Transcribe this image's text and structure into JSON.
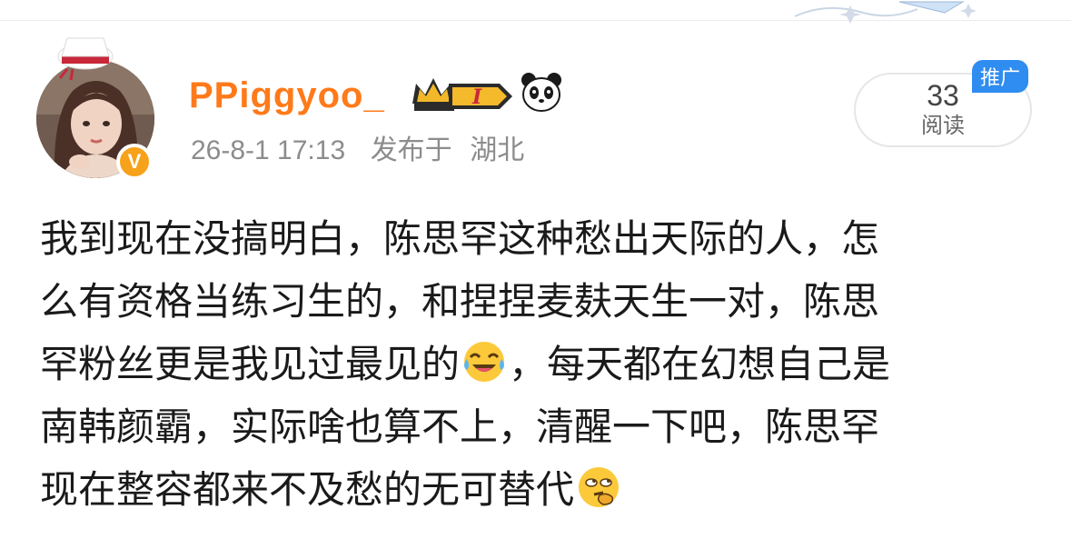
{
  "post": {
    "author": {
      "username": "PPiggyoo_",
      "verified_badge": "V",
      "level_badge": "I",
      "avatar_icon": "avatar-girl-icon",
      "badge_icons": [
        "crown-level-icon",
        "panda-icon"
      ]
    },
    "meta": {
      "time": "26-8-1 17:13",
      "published_prefix": "发布于",
      "location": "湖北"
    },
    "read": {
      "count": "33",
      "label": "阅读"
    },
    "promo_tag": "推广",
    "body": {
      "lines": [
        {
          "segments": [
            {
              "text": "我到现在没搞明白，陈思罕这种愁出天际的人，怎"
            }
          ]
        },
        {
          "segments": [
            {
              "text": "么有资格当练习生的，和捏捏麦麸天生一对，陈思"
            }
          ]
        },
        {
          "segments": [
            {
              "text": "罕粉丝更是我见过最见的"
            },
            {
              "emoji": "laugh-cry-emoji"
            },
            {
              "text": "，每天都在幻想自己是"
            }
          ]
        },
        {
          "segments": [
            {
              "text": "南韩颜霸，实际啥也算不上，清醒一下吧，陈思罕"
            }
          ]
        },
        {
          "segments": [
            {
              "text": "现在整容都来不及愁的无可替代"
            },
            {
              "emoji": "thinking-eyeroll-emoji"
            }
          ]
        }
      ]
    }
  },
  "colors": {
    "username": "#ff7a1a",
    "meta": "#8c8c8c",
    "promo": "#2f8cf0",
    "vbadge": "#f7a21b"
  }
}
